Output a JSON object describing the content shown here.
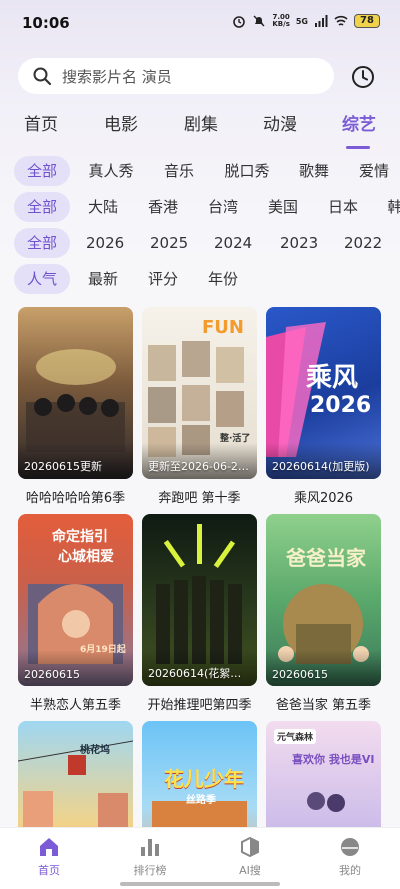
{
  "status_bar": {
    "time": "10:06",
    "net_speed_top": "7.00",
    "net_speed_bottom": "KB/s",
    "signal": "5G",
    "battery": "78"
  },
  "search": {
    "placeholder": "搜索影片名 演员"
  },
  "main_tabs": [
    "首页",
    "电影",
    "剧集",
    "动漫",
    "综艺"
  ],
  "main_tab_active": "综艺",
  "filters": {
    "type": [
      "全部",
      "真人秀",
      "音乐",
      "脱口秀",
      "歌舞",
      "爱情"
    ],
    "region": [
      "全部",
      "大陆",
      "香港",
      "台湾",
      "美国",
      "日本",
      "韩"
    ],
    "year": [
      "全部",
      "2026",
      "2025",
      "2024",
      "2023",
      "2022"
    ],
    "sort": [
      "人气",
      "最新",
      "评分",
      "年份"
    ]
  },
  "cards": [
    {
      "title": "哈哈哈哈哈第6季",
      "tag": "20260615更新",
      "color_top": "#8b6b45",
      "color_bottom": "#2b2a2e"
    },
    {
      "title": "奔跑吧 第十季",
      "tag": "更新至2026-06-2…",
      "color_top": "#f1eee6",
      "color_bottom": "#d9d2c2"
    },
    {
      "title": "乘风2026",
      "tag": "20260614(加更版)",
      "color_top": "#1c3f9a",
      "color_bottom": "#3c63d0"
    },
    {
      "title": "半熟恋人第五季",
      "tag": "20260615",
      "color_top": "#c64f35",
      "color_bottom": "#6d6a8a"
    },
    {
      "title": "开始推理吧第四季",
      "tag": "20260614(花絮第…",
      "color_top": "#1b2a1c",
      "color_bottom": "#3f4e22"
    },
    {
      "title": "爸爸当家 第五季",
      "tag": "20260615",
      "color_top": "#5a9a4a",
      "color_bottom": "#3c7a5a"
    },
    {
      "title": "",
      "tag": "",
      "color_top": "#7fc4ea",
      "color_bottom": "#c04a4a"
    },
    {
      "title": "",
      "tag": "",
      "color_top": "#5fb5f0",
      "color_bottom": "#e8a060"
    },
    {
      "title": "",
      "tag": "",
      "color_top": "#e8c8e8",
      "color_bottom": "#b9a7e6"
    }
  ],
  "poster_text": {
    "card2_fun": "FUN",
    "card2_note": "整·活了",
    "card3_main": "乘风",
    "card3_year": "2026",
    "card4_line1": "命定指引",
    "card4_line2": "心城相爱",
    "card4_date": "6月19日起",
    "card6_main": "爸爸当家",
    "card7_label": "桃花坞",
    "card8_main": "花儿少年",
    "card8_sub": "丝路季",
    "card9_brand": "元气森林",
    "card9_line": "喜欢你 我也是VI"
  },
  "bottom_nav": [
    {
      "label": "首页",
      "icon": "home-icon",
      "active": true
    },
    {
      "label": "排行榜",
      "icon": "ranking-icon",
      "active": false
    },
    {
      "label": "AI搜",
      "icon": "ai-search-icon",
      "active": false
    },
    {
      "label": "我的",
      "icon": "profile-icon",
      "active": false
    }
  ],
  "colors": {
    "accent": "#7b5cd6",
    "chip_active_bg": "#e4e0f7"
  }
}
